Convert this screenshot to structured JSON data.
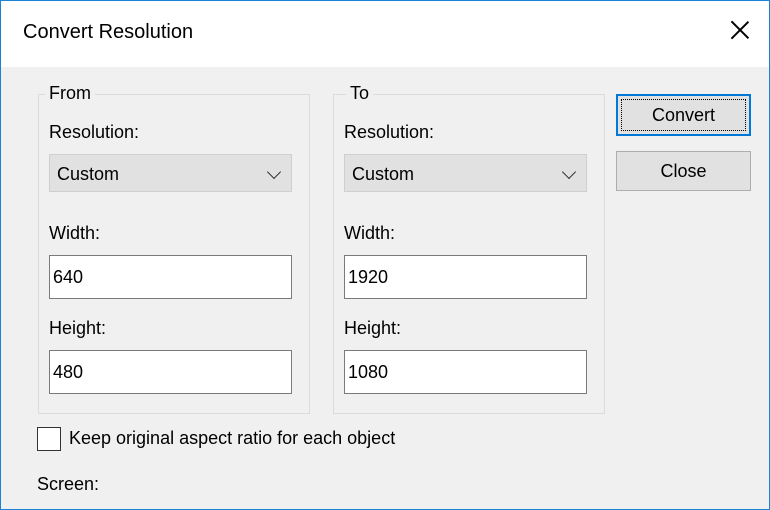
{
  "window": {
    "title": "Convert Resolution"
  },
  "from": {
    "legend": "From",
    "resolution_label": "Resolution:",
    "resolution_value": "Custom",
    "width_label": "Width:",
    "width_value": "640",
    "height_label": "Height:",
    "height_value": "480"
  },
  "to": {
    "legend": "To",
    "resolution_label": "Resolution:",
    "resolution_value": "Custom",
    "width_label": "Width:",
    "width_value": "1920",
    "height_label": "Height:",
    "height_value": "1080"
  },
  "buttons": {
    "convert": "Convert",
    "close": "Close"
  },
  "options": {
    "keep_aspect_label": "Keep original aspect ratio for each object",
    "keep_aspect_checked": false
  },
  "footer": {
    "screen_label": "Screen:"
  },
  "icons": {
    "close": "close-icon",
    "dropdown": "chevron-down-icon"
  }
}
